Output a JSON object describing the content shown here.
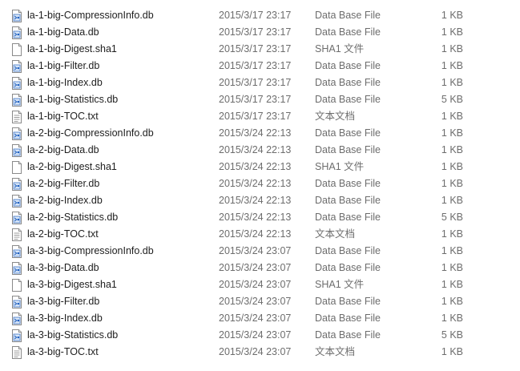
{
  "files": [
    {
      "name": "la-1-big-CompressionInfo.db",
      "date": "2015/3/17 23:17",
      "type": "Data Base File",
      "size": "1 KB",
      "icon": "db-file-icon"
    },
    {
      "name": "la-1-big-Data.db",
      "date": "2015/3/17 23:17",
      "type": "Data Base File",
      "size": "1 KB",
      "icon": "db-file-icon"
    },
    {
      "name": "la-1-big-Digest.sha1",
      "date": "2015/3/17 23:17",
      "type": "SHA1 文件",
      "size": "1 KB",
      "icon": "blank-file-icon"
    },
    {
      "name": "la-1-big-Filter.db",
      "date": "2015/3/17 23:17",
      "type": "Data Base File",
      "size": "1 KB",
      "icon": "db-file-icon"
    },
    {
      "name": "la-1-big-Index.db",
      "date": "2015/3/17 23:17",
      "type": "Data Base File",
      "size": "1 KB",
      "icon": "db-file-icon"
    },
    {
      "name": "la-1-big-Statistics.db",
      "date": "2015/3/17 23:17",
      "type": "Data Base File",
      "size": "5 KB",
      "icon": "db-file-icon"
    },
    {
      "name": "la-1-big-TOC.txt",
      "date": "2015/3/17 23:17",
      "type": "文本文档",
      "size": "1 KB",
      "icon": "text-file-icon"
    },
    {
      "name": "la-2-big-CompressionInfo.db",
      "date": "2015/3/24 22:13",
      "type": "Data Base File",
      "size": "1 KB",
      "icon": "db-file-icon"
    },
    {
      "name": "la-2-big-Data.db",
      "date": "2015/3/24 22:13",
      "type": "Data Base File",
      "size": "1 KB",
      "icon": "db-file-icon"
    },
    {
      "name": "la-2-big-Digest.sha1",
      "date": "2015/3/24 22:13",
      "type": "SHA1 文件",
      "size": "1 KB",
      "icon": "blank-file-icon"
    },
    {
      "name": "la-2-big-Filter.db",
      "date": "2015/3/24 22:13",
      "type": "Data Base File",
      "size": "1 KB",
      "icon": "db-file-icon"
    },
    {
      "name": "la-2-big-Index.db",
      "date": "2015/3/24 22:13",
      "type": "Data Base File",
      "size": "1 KB",
      "icon": "db-file-icon"
    },
    {
      "name": "la-2-big-Statistics.db",
      "date": "2015/3/24 22:13",
      "type": "Data Base File",
      "size": "5 KB",
      "icon": "db-file-icon"
    },
    {
      "name": "la-2-big-TOC.txt",
      "date": "2015/3/24 22:13",
      "type": "文本文档",
      "size": "1 KB",
      "icon": "text-file-icon"
    },
    {
      "name": "la-3-big-CompressionInfo.db",
      "date": "2015/3/24 23:07",
      "type": "Data Base File",
      "size": "1 KB",
      "icon": "db-file-icon"
    },
    {
      "name": "la-3-big-Data.db",
      "date": "2015/3/24 23:07",
      "type": "Data Base File",
      "size": "1 KB",
      "icon": "db-file-icon"
    },
    {
      "name": "la-3-big-Digest.sha1",
      "date": "2015/3/24 23:07",
      "type": "SHA1 文件",
      "size": "1 KB",
      "icon": "blank-file-icon"
    },
    {
      "name": "la-3-big-Filter.db",
      "date": "2015/3/24 23:07",
      "type": "Data Base File",
      "size": "1 KB",
      "icon": "db-file-icon"
    },
    {
      "name": "la-3-big-Index.db",
      "date": "2015/3/24 23:07",
      "type": "Data Base File",
      "size": "1 KB",
      "icon": "db-file-icon"
    },
    {
      "name": "la-3-big-Statistics.db",
      "date": "2015/3/24 23:07",
      "type": "Data Base File",
      "size": "5 KB",
      "icon": "db-file-icon"
    },
    {
      "name": "la-3-big-TOC.txt",
      "date": "2015/3/24 23:07",
      "type": "文本文档",
      "size": "1 KB",
      "icon": "text-file-icon"
    }
  ]
}
